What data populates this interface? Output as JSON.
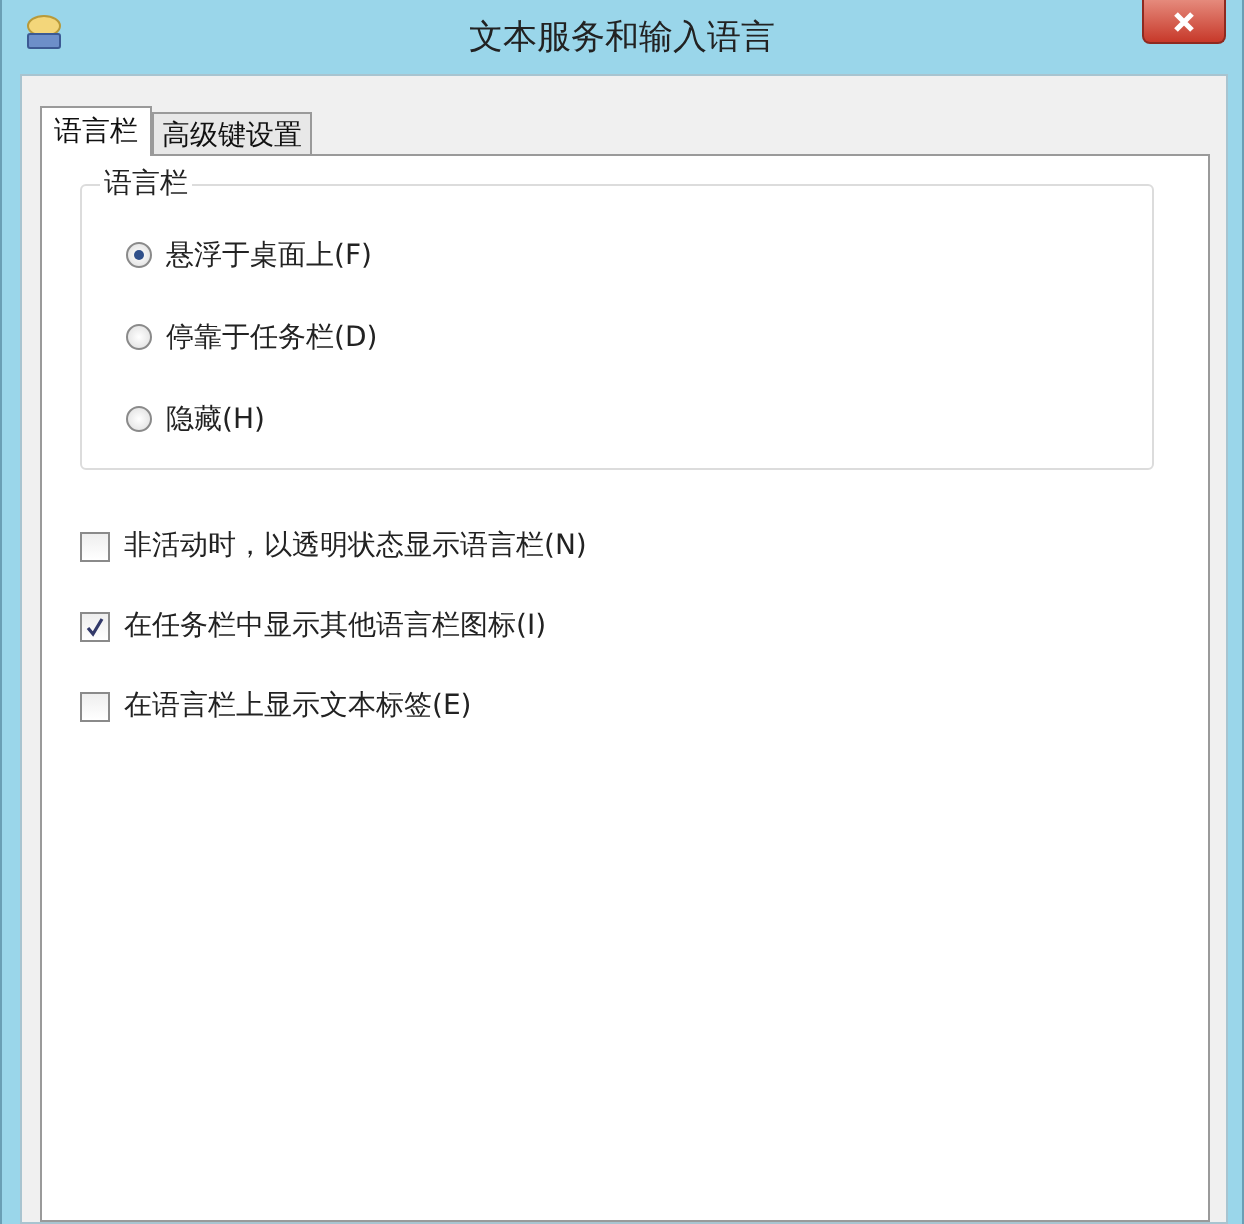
{
  "window": {
    "title": "文本服务和输入语言"
  },
  "tabs": [
    {
      "label": "语言栏",
      "selected": true
    },
    {
      "label": "高级键设置",
      "selected": false
    }
  ],
  "group": {
    "title": "语言栏",
    "options": [
      {
        "label": "悬浮于桌面上(F)",
        "selected": true
      },
      {
        "label": "停靠于任务栏(D)",
        "selected": false
      },
      {
        "label": "隐藏(H)",
        "selected": false
      }
    ]
  },
  "checkboxes": [
    {
      "label": "非活动时，以透明状态显示语言栏(N)",
      "checked": false
    },
    {
      "label": "在任务栏中显示其他语言栏图标(I)",
      "checked": true
    },
    {
      "label": "在语言栏上显示文本标签(E)",
      "checked": false
    }
  ]
}
